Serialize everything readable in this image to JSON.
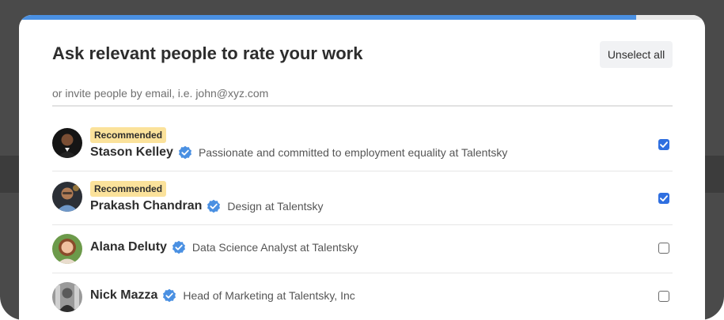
{
  "colors": {
    "progress": "#4a90e2",
    "badge_bg": "#fbe29b",
    "verified": "#4a90e2",
    "checkbox_on": "#2f6fe0"
  },
  "modal": {
    "progress_fraction": 0.9,
    "title": "Ask relevant people to rate your work",
    "unselect_all_label": "Unselect all",
    "email_placeholder": "or invite people by email, i.e. john@xyz.com"
  },
  "people": [
    {
      "badge": "Recommended",
      "name": "Stason Kelley",
      "description": "Passionate and committed to employment equality at Talentsky",
      "checked": true,
      "verified_icon": "verified-badge-icon"
    },
    {
      "badge": "Recommended",
      "name": "Prakash Chandran",
      "description": "Design at Talentsky",
      "checked": true,
      "verified_icon": "verified-badge-icon"
    },
    {
      "badge": "",
      "name": "Alana Deluty",
      "description": "Data Science Analyst at Talentsky",
      "checked": false,
      "verified_icon": "verified-badge-icon"
    },
    {
      "badge": "",
      "name": "Nick Mazza",
      "description": "Head of Marketing at Talentsky, Inc",
      "checked": false,
      "verified_icon": "verified-badge-icon"
    }
  ]
}
